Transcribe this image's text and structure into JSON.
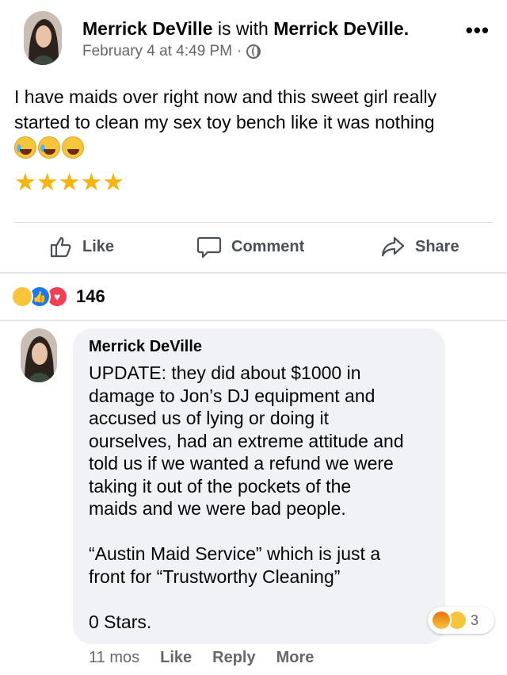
{
  "post": {
    "author": "Merrick DeVille",
    "with_text": "is with",
    "tagged": "Merrick DeVille.",
    "timestamp": "February 4 at 4:49 PM",
    "separator": "·",
    "privacy_icon": "globe-icon",
    "more_label": "•••",
    "body": "I have maids over right now and this sweet girl really started to clean my sex toy bench like it was nothing",
    "emojis": [
      "crying-face",
      "tears-of-joy",
      "grinning-sweat"
    ],
    "stars": "★★★★★"
  },
  "actions": {
    "like": "Like",
    "comment": "Comment",
    "share": "Share"
  },
  "reactions": {
    "icons": [
      "haha",
      "like",
      "love"
    ],
    "count": "146"
  },
  "comment": {
    "author": "Merrick DeVille",
    "text": "UPDATE: they did about $1000 in\ndamage to Jon’s DJ equipment and\naccused us of lying or doing it\nourselves, had an extreme attitude and\ntold us if we wanted a refund we were\ntaking it out of the pockets of the\nmaids and we were bad people.\n\n“Austin Maid Service” which is just a\nfront for “Trustworthy Cleaning”\n\n0 Stars.",
    "reactions": {
      "icons": [
        "angry",
        "wow"
      ],
      "count": "3"
    },
    "time": "11 mos",
    "like": "Like",
    "reply": "Reply",
    "more": "More"
  },
  "colors": {
    "brand_blue": "#1877f2",
    "secondary_text": "#65676b",
    "bubble_bg": "#f0f2f5",
    "star": "#f6b40e"
  }
}
